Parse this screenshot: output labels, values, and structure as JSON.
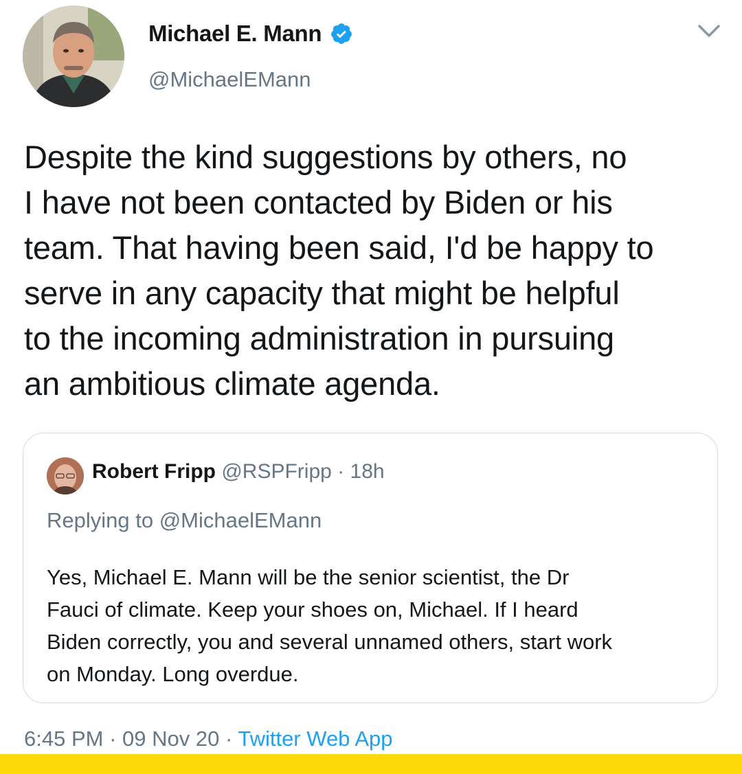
{
  "tweet": {
    "author_name": "Michael E. Mann",
    "author_handle": "@MichaelEMann",
    "text": "Despite the kind suggestions by others, no\nI have not been contacted by Biden or his\nteam. That having been said, I'd be happy to\nserve in any capacity that might be helpful\nto the incoming administration in pursuing\nan ambitious climate agenda.",
    "time": "6:45 PM",
    "date": "09 Nov 20",
    "source": "Twitter Web App",
    "separator": " · "
  },
  "quoted": {
    "author_name": "Robert Fripp",
    "author_handle": "@RSPFripp",
    "age": "18h",
    "replying_to": "Replying to @MichaelEMann",
    "text": "Yes, Michael E. Mann will be the senior scientist, the Dr\nFauci of climate. Keep your shoes on, Michael. If I heard\nBiden correctly, you and several unnamed others, start work\non Monday. Long overdue."
  },
  "icons": {
    "verified": "verified-badge-icon",
    "menu": "chevron-down-icon"
  },
  "colors": {
    "verified": "#1da1f2",
    "link": "#1da1f2",
    "muted": "#657786",
    "bottom_bar": "#ffda0a"
  }
}
